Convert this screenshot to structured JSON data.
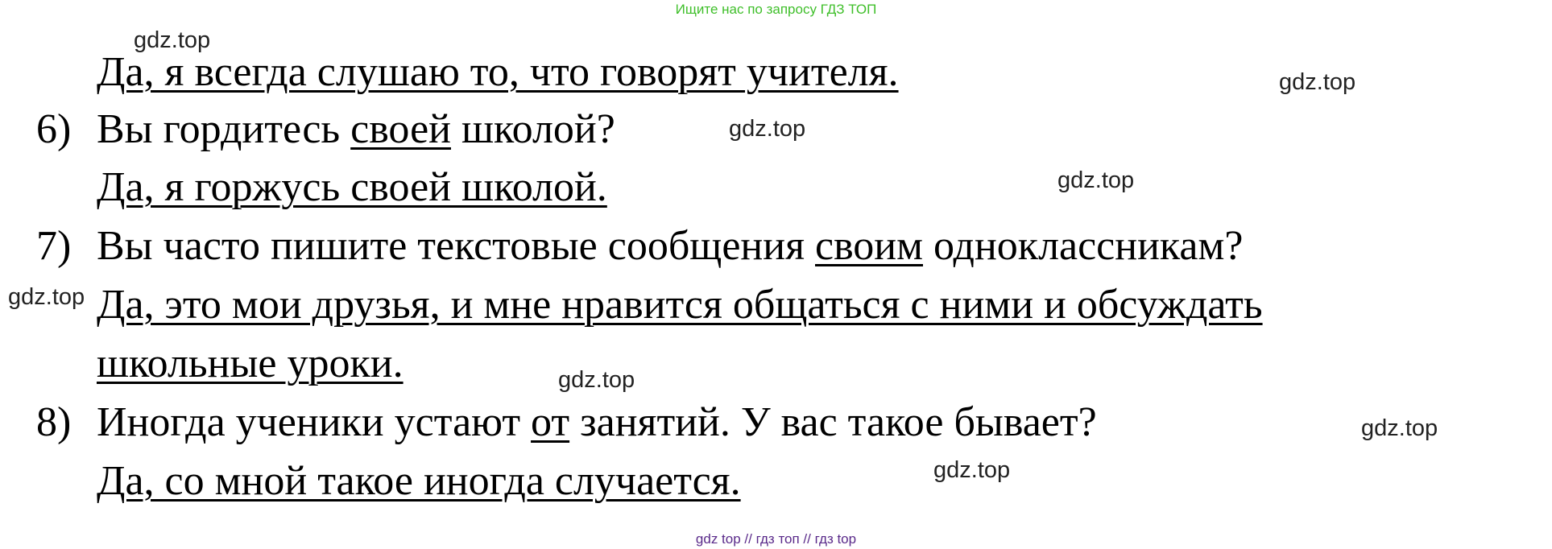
{
  "banner_top": "Ищите нас по запросу ГДЗ ТОП",
  "banner_bottom": "gdz top  //  гдз топ  //  гдз top",
  "watermark": "gdz.top",
  "answer5": "Да, я всегда слушаю то, что говорят учителя.",
  "q6": {
    "num": "6)",
    "pre": "Вы гордитесь ",
    "underlined": "своей",
    "post": " школой?",
    "answer": "Да, я горжусь своей школой."
  },
  "q7": {
    "num": "7)",
    "pre": "Вы часто пишите текстовые сообщения ",
    "underlined": "своим",
    "post": " одноклассникам?",
    "answer_line1": "Да, это мои друзья, и мне нравится общаться с ними и обсуждать",
    "answer_line2": "школьные уроки."
  },
  "q8": {
    "num": "8)",
    "pre": "Иногда ученики устают ",
    "underlined": "от",
    "post": " занятий. У вас такое бывает?",
    "answer": "Да, со мной такое иногда случается."
  }
}
